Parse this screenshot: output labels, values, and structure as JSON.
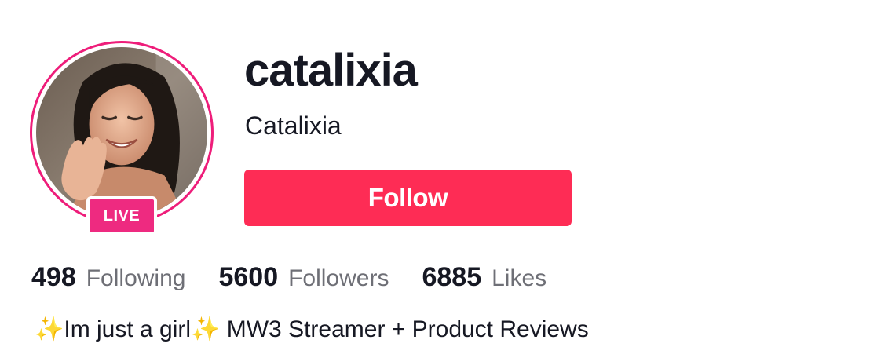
{
  "profile": {
    "username": "catalixia",
    "nickname": "Catalixia",
    "live_badge": "LIVE",
    "follow_label": "Follow",
    "bio": "✨Im just a girl✨ MW3 Streamer + Product Reviews"
  },
  "stats": [
    {
      "count": "498",
      "label": "Following"
    },
    {
      "count": "5600",
      "label": "Followers"
    },
    {
      "count": "6885",
      "label": "Likes"
    }
  ],
  "colors": {
    "accent": "#fe2c55",
    "live_ring": "#ee1d7a",
    "live_badge": "#ee2a80",
    "text_primary": "#161823",
    "text_secondary": "#6e6f76"
  }
}
